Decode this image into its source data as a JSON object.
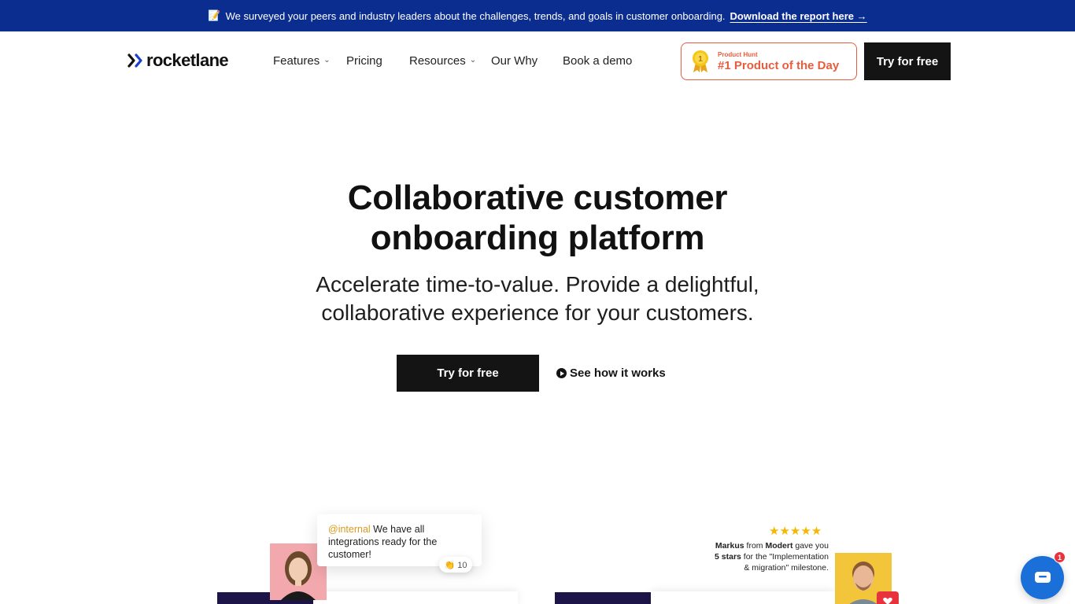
{
  "banner": {
    "icon": "memo-icon",
    "text": "We surveyed your peers and industry leaders about the challenges, trends, and goals in customer onboarding.",
    "link": "Download the report here →",
    "bg_color": "#0b2d8f"
  },
  "nav": {
    "logo": "rocketlane",
    "logo_color": "#1a3fd1",
    "items": [
      {
        "label": "Features",
        "has_dropdown": true
      },
      {
        "label": "Pricing",
        "has_dropdown": false
      },
      {
        "label": "Resources",
        "has_dropdown": true
      },
      {
        "label": "Our Why",
        "has_dropdown": false
      },
      {
        "label": "Book a demo",
        "has_dropdown": false
      }
    ],
    "product_hunt": {
      "small": "Product Hunt",
      "big": "#1 Product of the Day",
      "accent": "#e85d3f"
    },
    "cta": "Try for free"
  },
  "hero": {
    "title_line1": "Collaborative customer",
    "title_line2": "onboarding platform",
    "subtitle_line1": "Accelerate time-to-value. Provide a delightful,",
    "subtitle_line2": "collaborative experience for your customers.",
    "primary_cta": "Try for free",
    "secondary_cta": "See how it works"
  },
  "preview": {
    "comment": {
      "mention": "@internal",
      "text": " We have all integrations ready for the customer!",
      "reaction": "👏 10"
    },
    "review": {
      "stars": "★★★★★",
      "name": "Markus",
      "from_text": " from ",
      "company": "Modert",
      "gave_text": " gave you ",
      "rating": "5 stars",
      "rest": " for the \"Implementation & migration\" milestone."
    }
  },
  "chat": {
    "badge_count": "1",
    "color": "#1a6fd8"
  }
}
